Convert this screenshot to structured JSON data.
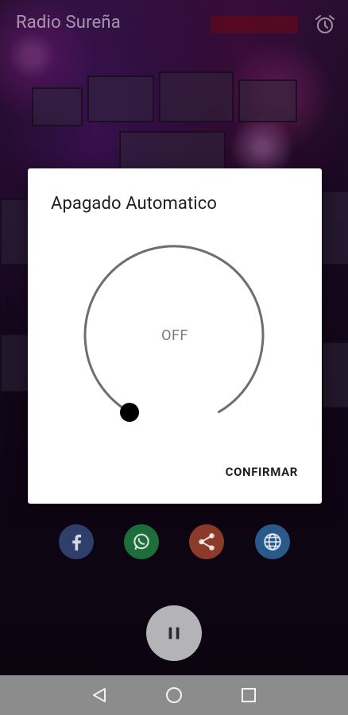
{
  "app": {
    "title": "Radio Sureña"
  },
  "dialog": {
    "title": "Apagado Automatico",
    "dial_value": "OFF",
    "confirm_label": "CONFIRMAR"
  },
  "social": [
    {
      "icon": "facebook-icon",
      "color": "#3b5998"
    },
    {
      "icon": "whatsapp-icon",
      "color": "#1ea855"
    },
    {
      "icon": "share-icon",
      "color": "#e8582b"
    },
    {
      "icon": "globe-icon",
      "color": "#2f8ee0"
    }
  ],
  "player": {
    "state_icon": "pause-icon"
  },
  "navigation": [
    "back-icon",
    "home-icon",
    "recents-icon"
  ]
}
